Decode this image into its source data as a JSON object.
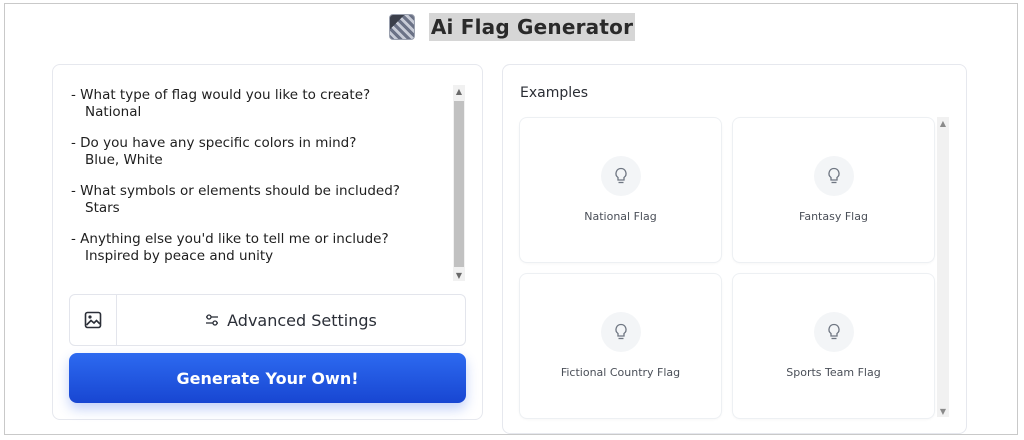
{
  "header": {
    "title": "Ai Flag Generator",
    "logo_icon": "qr-logo-icon"
  },
  "prompt": {
    "items": [
      {
        "question": "- What type of flag would you like to create?",
        "answer": "National"
      },
      {
        "question": "- Do you have any specific colors in mind?",
        "answer": "Blue, White"
      },
      {
        "question": "- What symbols or elements should be included?",
        "answer": "Stars"
      },
      {
        "question": "- Anything else you'd like to tell me or include?",
        "answer": "Inspired by peace and unity"
      }
    ]
  },
  "controls": {
    "image_icon": "image-icon",
    "advanced_label": "Advanced Settings",
    "advanced_icon": "sliders-icon",
    "generate_label": "Generate Your Own!"
  },
  "examples": {
    "title": "Examples",
    "cards": [
      {
        "label": "National Flag",
        "icon": "lightbulb-icon"
      },
      {
        "label": "Fantasy Flag",
        "icon": "lightbulb-icon"
      },
      {
        "label": "Fictional Country Flag",
        "icon": "lightbulb-icon"
      },
      {
        "label": "Sports Team Flag",
        "icon": "lightbulb-icon"
      }
    ]
  },
  "colors": {
    "accent": "#1f56e0",
    "border": "#e6e8ee",
    "title_highlight": "#d6d6d6"
  }
}
